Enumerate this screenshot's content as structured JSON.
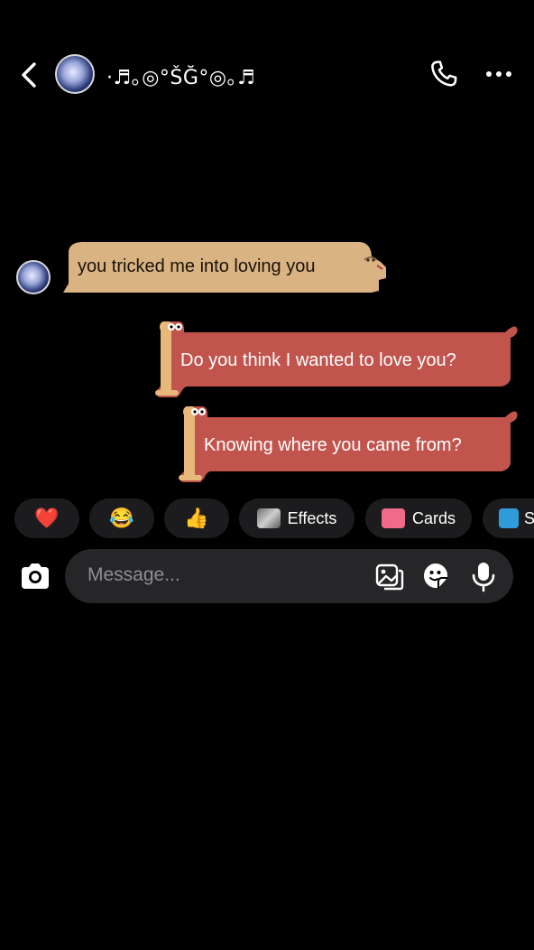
{
  "header": {
    "contact_name": "·♬｡◎°ŠĞ°◎｡♬"
  },
  "messages": [
    {
      "sender": "them",
      "text": "you tricked me into loving you",
      "bubble_color": "#d9b382"
    },
    {
      "sender": "me",
      "text": "Do you think I wanted to love you?",
      "bubble_color": "#c1554d"
    },
    {
      "sender": "me",
      "text": "Knowing where you came from?",
      "bubble_color": "#c1554d"
    }
  ],
  "quick_actions": {
    "heart": "❤️",
    "laugh": "😂",
    "thumbs_up": "👍",
    "effects_label": "Effects",
    "cards_label": "Cards",
    "partial_label": "S"
  },
  "composer": {
    "placeholder": "Message..."
  },
  "colors": {
    "background": "#000000",
    "received_bubble": "#d9b382",
    "sent_bubble": "#c1554d",
    "chip_bg": "#1c1c1e",
    "composer_bg": "#262628"
  },
  "icons": [
    "back-chevron-icon",
    "phone-icon",
    "more-icon",
    "camera-icon",
    "gallery-icon",
    "sticker-icon",
    "microphone-icon"
  ]
}
